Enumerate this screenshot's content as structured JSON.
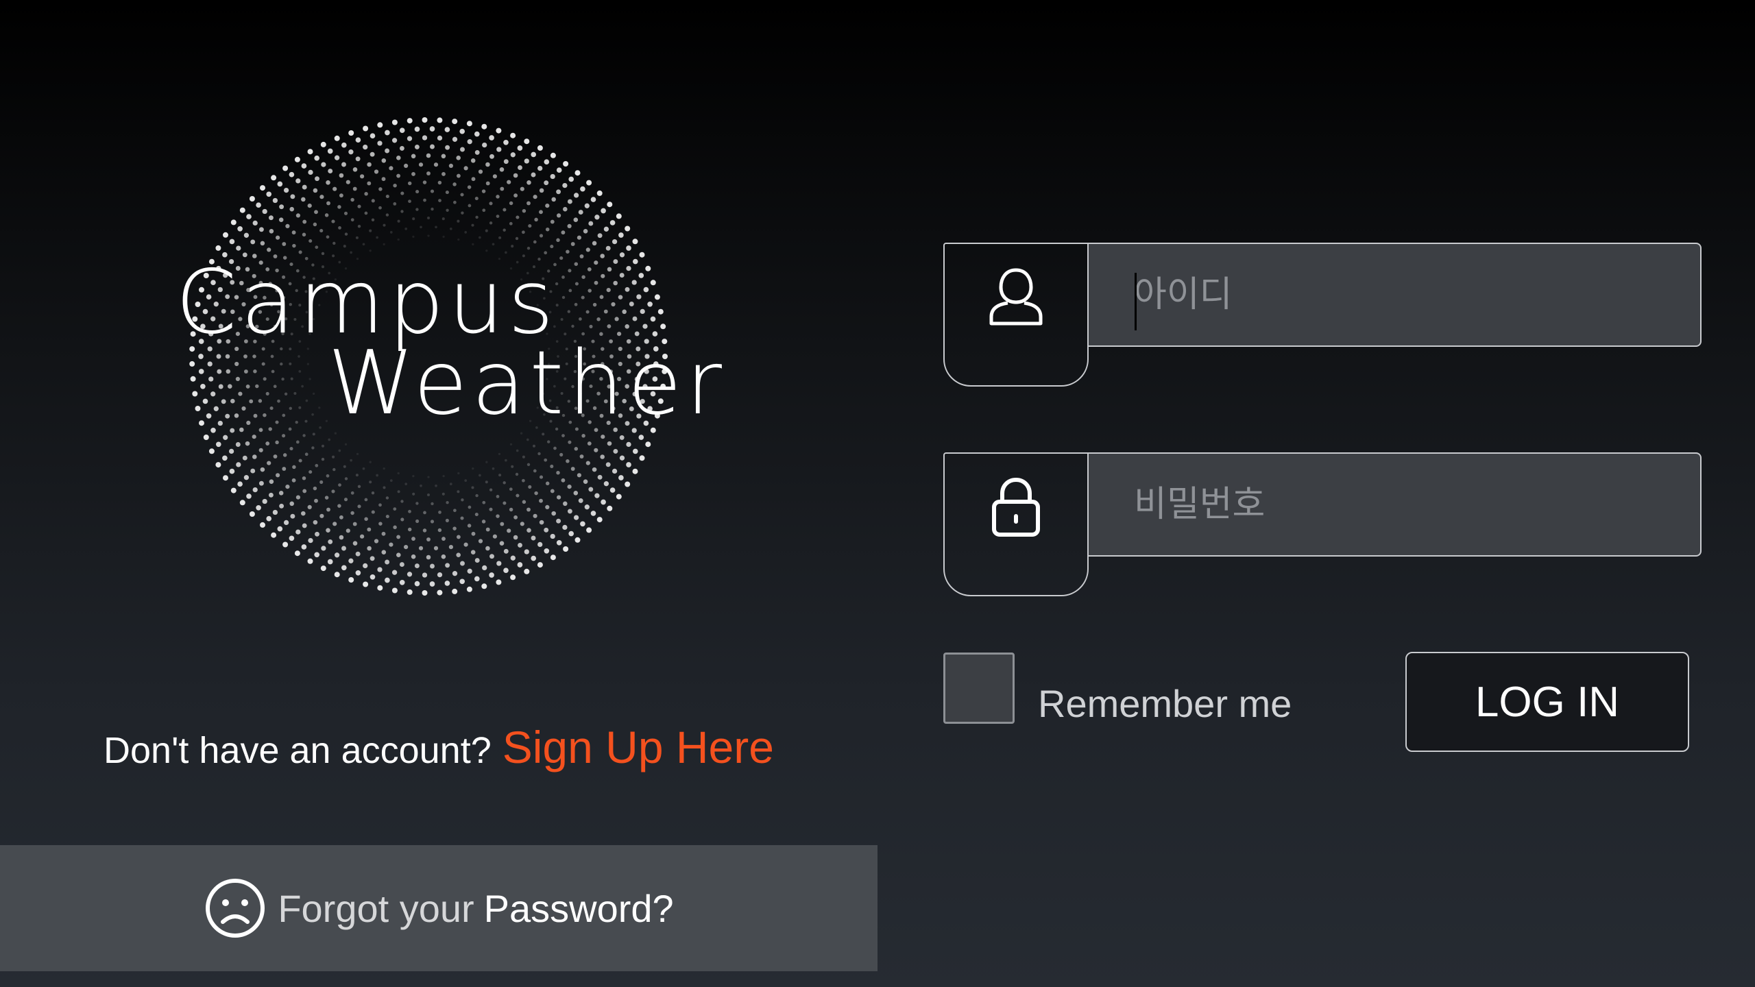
{
  "logo": {
    "line1": "Campus",
    "line2": "Weather"
  },
  "signup": {
    "prompt": "Don't have an account?",
    "link": "Sign Up Here"
  },
  "forgot": {
    "icon": "sad-face-icon",
    "prefix": "Forgot your",
    "strong": "Password?"
  },
  "form": {
    "username": {
      "icon": "user-icon",
      "placeholder": "아이디",
      "value": ""
    },
    "password": {
      "icon": "lock-icon",
      "placeholder": "비밀번호",
      "value": ""
    },
    "remember": {
      "label": "Remember me",
      "checked": false
    },
    "login_label": "LOG IN"
  },
  "colors": {
    "accent": "#f4511e",
    "input_bg": "#3c3f44",
    "border": "#c9cbcf",
    "forgot_bar": "#474b50"
  }
}
